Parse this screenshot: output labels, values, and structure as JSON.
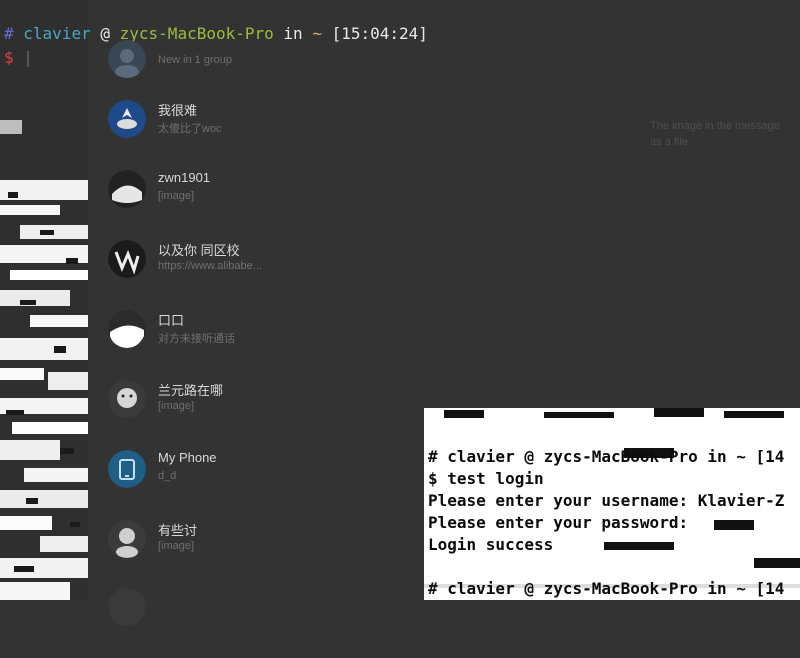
{
  "terminal_prompt": {
    "hash": "#",
    "user": "clavier",
    "at": "@",
    "host": "zycs-MacBook-Pro",
    "in": "in",
    "dir": "~",
    "time": "[15:04:24]",
    "dollar": "$",
    "cursor": "|"
  },
  "chat_list": {
    "items": [
      {
        "name": "",
        "preview": "New in 1 group"
      },
      {
        "name": "我很难",
        "preview": "太傻比了woc"
      },
      {
        "name": "zwn1901",
        "preview": "[image]"
      },
      {
        "name": "以及你 同区校",
        "preview": "https://www.alibabe..."
      },
      {
        "name": "口口",
        "preview": "对方未接听通话"
      },
      {
        "name": "兰元路在哪",
        "preview": "[image]"
      },
      {
        "name": "My Phone",
        "preview": "d_d"
      },
      {
        "name": "有些讨",
        "preview": "[image]"
      },
      {
        "name": "",
        "preview": ""
      }
    ]
  },
  "ghost_message": {
    "line1": "The image in the message",
    "line2": "as a file"
  },
  "terminal_panel": {
    "lines": [
      "# clavier @ zycs-MacBook-Pro in ~ [14",
      "$ test login",
      "Please enter your username: Klavier-Z",
      "Please enter your password:",
      "Login success",
      "",
      "# clavier @ zycs-MacBook-Pro in ~ [14",
      "$ |"
    ]
  }
}
